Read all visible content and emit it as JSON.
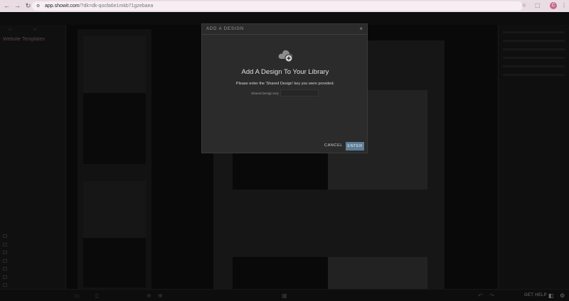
{
  "browser": {
    "url_host": "app.showit.com",
    "url_path": "/?dk=dk-qocfa6e1mkb71gzebaea",
    "avatar_initial": "C"
  },
  "editor": {
    "left_panel_title": "Website Templates",
    "get_help": "GET HELP"
  },
  "modal": {
    "title": "ADD A DESIGN",
    "close_glyph": "×",
    "heading": "Add A Design To Your Library",
    "description": "Please enter the 'Shared Design' key you were provided.",
    "key_label": "Shared Design Key",
    "key_value": "",
    "cancel_label": "CANCEL",
    "enter_label": "ENTER"
  },
  "colors": {
    "enter_button": "#5e7f97",
    "modal_background": "#2b2b2b",
    "browser_bar": "#e9dde3",
    "avatar": "#c76b8c"
  },
  "icons": {
    "modal": "cloud-add-icon",
    "close": "close-icon"
  }
}
